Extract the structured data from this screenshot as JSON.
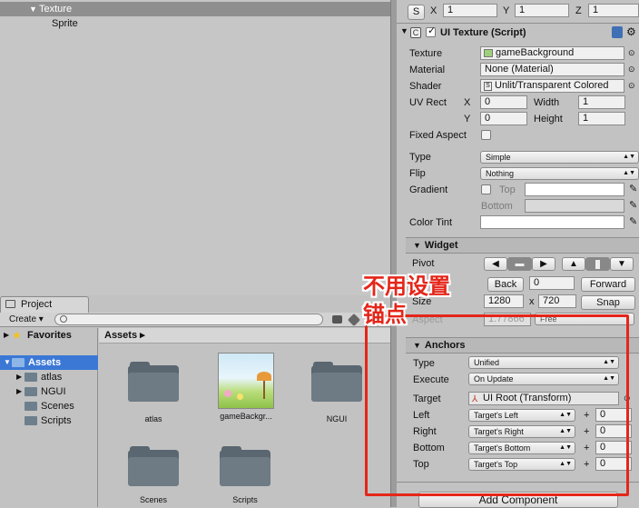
{
  "hierarchy": {
    "items": [
      {
        "label": "Texture",
        "arrow": "▼"
      },
      {
        "label": "Sprite"
      }
    ]
  },
  "project": {
    "tab_label": "Project",
    "create_label": "Create ▾",
    "tree": {
      "favorites": "Favorites",
      "assets": "Assets",
      "children": [
        "atlas",
        "NGUI",
        "Scenes",
        "Scripts"
      ]
    },
    "breadcrumb": "Assets ▸",
    "assets": [
      {
        "label": "atlas"
      },
      {
        "label": "gameBackgr..."
      },
      {
        "label": "NGUI"
      },
      {
        "label": "Scenes"
      },
      {
        "label": "Scripts"
      }
    ]
  },
  "inspector": {
    "scale": {
      "s": "S",
      "x_label": "X",
      "x": "1",
      "y_label": "Y",
      "y": "1",
      "z_label": "Z",
      "z": "1"
    },
    "component_title": "UI Texture (Script)",
    "texture_label": "Texture",
    "texture_value": "gameBackground",
    "material_label": "Material",
    "material_value": "None (Material)",
    "shader_label": "Shader",
    "shader_value": "Unlit/Transparent Colored",
    "uvrect_label": "UV Rect",
    "uv_x_label": "X",
    "uv_x": "0",
    "uv_width_label": "Width",
    "uv_width": "1",
    "uv_y_label": "Y",
    "uv_y": "0",
    "uv_height_label": "Height",
    "uv_height": "1",
    "fixed_aspect_label": "Fixed Aspect",
    "type_label": "Type",
    "type_value": "Simple",
    "flip_label": "Flip",
    "flip_value": "Nothing",
    "gradient_label": "Gradient",
    "gradient_top_label": "Top",
    "gradient_bottom_label": "Bottom",
    "color_tint_label": "Color Tint",
    "widget_title": "Widget",
    "pivot_label": "Pivot",
    "depth_back": "Back",
    "depth_value": "0",
    "depth_forward": "Forward",
    "size_label": "Size",
    "size_w": "1280",
    "size_x": "x",
    "size_h": "720",
    "snap_label": "Snap",
    "aspect_label": "Aspect",
    "aspect_value": "1.77866",
    "aspect_mode": "Free",
    "anchors_title": "Anchors",
    "anchor_type_label": "Type",
    "anchor_type_value": "Unified",
    "execute_label": "Execute",
    "execute_value": "On Update",
    "target_label": "Target",
    "target_value": "UI Root (Transform)",
    "anchor_rows": [
      {
        "label": "Left",
        "target": "Target's Left",
        "plus": "+",
        "value": "0"
      },
      {
        "label": "Right",
        "target": "Target's Right",
        "plus": "+",
        "value": "0"
      },
      {
        "label": "Bottom",
        "target": "Target's Bottom",
        "plus": "+",
        "value": "0"
      },
      {
        "label": "Top",
        "target": "Target's Top",
        "plus": "+",
        "value": "0"
      }
    ],
    "add_component_label": "Add Component"
  },
  "annotation": {
    "line1": "不用设置",
    "line2": "锚点",
    "color": "#e4261a"
  },
  "colors": {
    "selection": "#3b78d6",
    "panel": "#c2c2c2"
  }
}
